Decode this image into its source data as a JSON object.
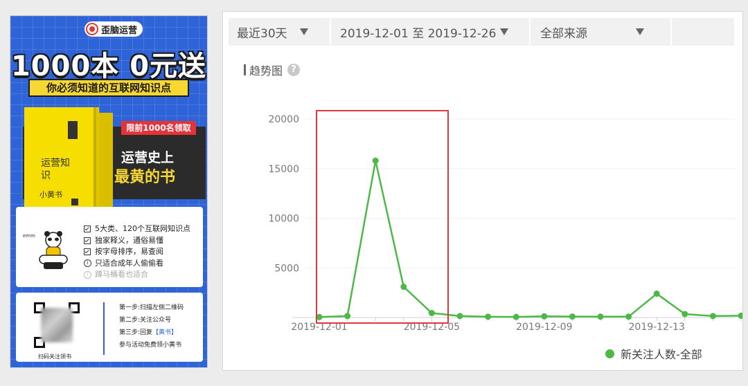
{
  "poster": {
    "brand": "歪脑运营",
    "headline": "1000本 0元送",
    "subtitle": "你必须知道的互联网知识点",
    "ribbon": "限前1000名领取",
    "book_title": "运营知识",
    "book_subtitle": "小黄书",
    "tagline_1": "运营史上",
    "tagline_2": "最黄的书",
    "mascot_caption": "emm",
    "features": [
      "5大类、120个互联网知识点",
      "独家释义，通俗易懂",
      "按字母排序，易查阅"
    ],
    "notices": [
      "只适合成年人偷偷看",
      "蹲马桶看也适合"
    ],
    "qr_caption": "扫码关注领书",
    "steps": {
      "step1": "第一步:扫描左侧二维码",
      "step2": "第二步:关注公众号",
      "step3_prefix": "第三步:回复",
      "step3_keyword": "【黄书】",
      "step4": "参与活动免费领小黄书"
    }
  },
  "filters": {
    "period": "最近30天",
    "date_range": "2019-12-01 至 2019-12-26",
    "source": "全部来源"
  },
  "chart_title": "趋势图",
  "chart_data": {
    "type": "line",
    "title": "趋势图",
    "xlabel": "",
    "ylabel": "",
    "x_tick_labels": [
      "2019-12-01",
      "2019-12-05",
      "2019-12-09",
      "2019-12-13"
    ],
    "ylim": [
      0,
      20000
    ],
    "y_ticks": [
      5000,
      10000,
      15000,
      20000
    ],
    "grid": true,
    "legend_position": "bottom-right",
    "series": [
      {
        "name": "新关注人数-全部",
        "color": "#4cb848",
        "x": [
          "2019-12-01",
          "2019-12-02",
          "2019-12-03",
          "2019-12-04",
          "2019-12-05",
          "2019-12-06",
          "2019-12-07",
          "2019-12-08",
          "2019-12-09",
          "2019-12-10",
          "2019-12-11",
          "2019-12-12",
          "2019-12-13",
          "2019-12-14",
          "2019-12-15",
          "2019-12-16"
        ],
        "values": [
          50,
          150,
          15800,
          3100,
          450,
          150,
          80,
          60,
          120,
          100,
          90,
          90,
          2400,
          350,
          150,
          180
        ]
      }
    ]
  },
  "legend_label": "新关注人数-全部"
}
